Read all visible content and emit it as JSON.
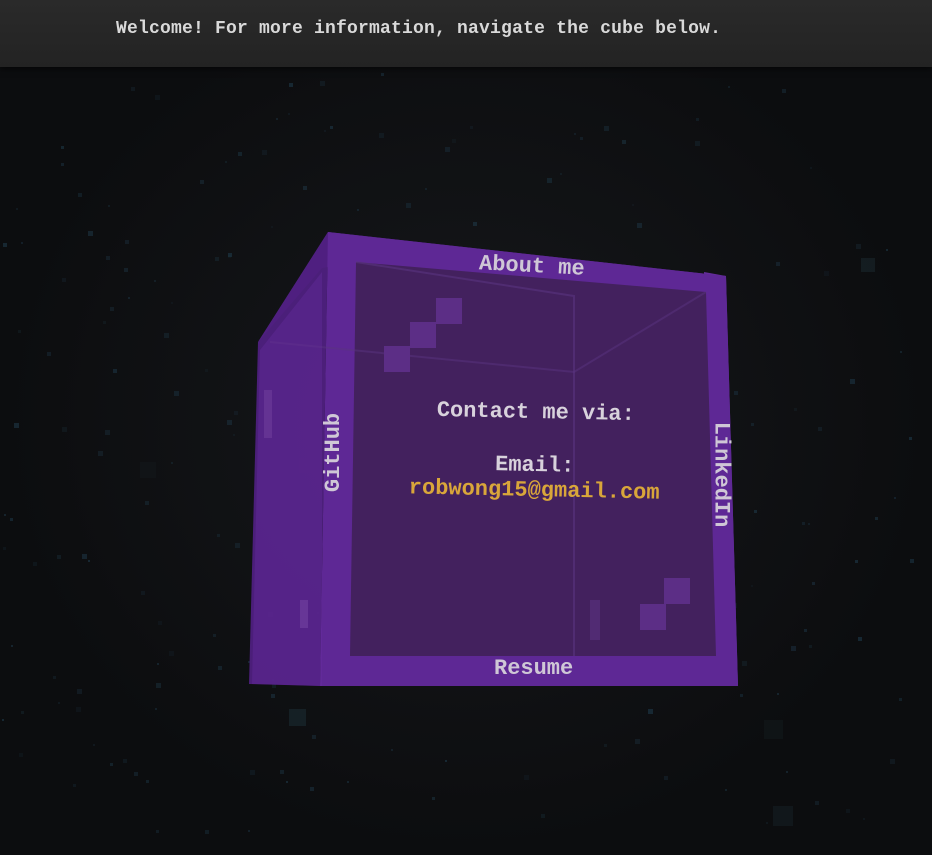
{
  "header": {
    "welcome_text": "Welcome! For more information, navigate the cube below."
  },
  "cube": {
    "faces": {
      "top_label": "About me",
      "left_label": "GitHub",
      "right_label": "LinkedIn",
      "bottom_label": "Resume"
    },
    "contact": {
      "heading": "Contact me via:",
      "email_label": "Email:",
      "email_address": "robwong15@gmail.com"
    }
  },
  "colors": {
    "cube_purple": "#5b2591",
    "cube_face": "#42205c",
    "email_accent": "#d9a63a",
    "label_text": "#cfc7d6",
    "header_bg": "#262626"
  }
}
